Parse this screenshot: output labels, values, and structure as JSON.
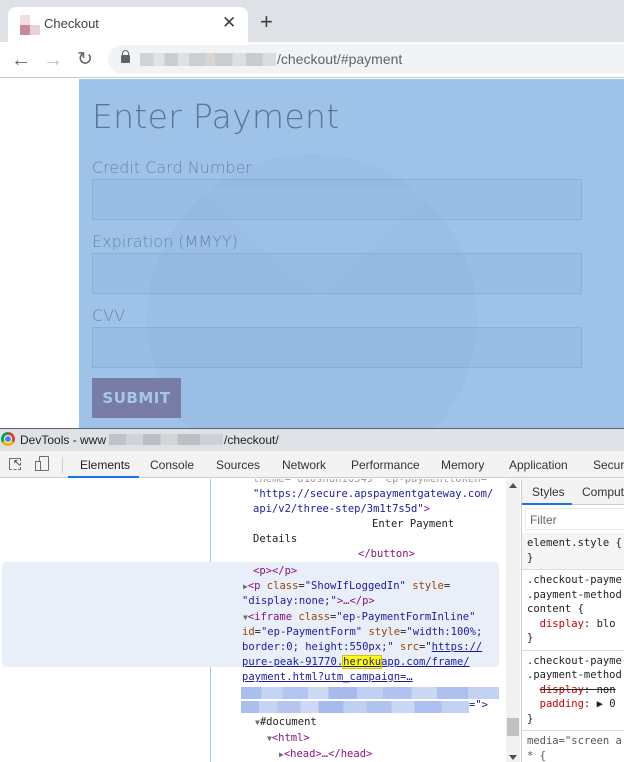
{
  "browser": {
    "tab": {
      "title": "Checkout",
      "close_glyph": "✕"
    },
    "new_tab_glyph": "+",
    "nav": {
      "back_glyph": "←",
      "forward_glyph": "→",
      "reload_glyph": "↻"
    },
    "address_bar": {
      "url_visible_suffix": "/checkout/#payment",
      "secure": true
    }
  },
  "page": {
    "title": "Enter Payment",
    "fields": [
      {
        "label": "Credit Card Number",
        "value": ""
      },
      {
        "label": "Expiration (MMYY)",
        "value": ""
      },
      {
        "label": "CVV",
        "value": ""
      }
    ],
    "submit_label": "SUBMIT",
    "colors": {
      "panel_bg": "#9fc3e8",
      "button_bg": "#7a7ca8",
      "title_color": "#557799"
    }
  },
  "devtools": {
    "window_title_prefix": "DevTools - www",
    "window_title_suffix": "/checkout/",
    "tabs": [
      "Elements",
      "Console",
      "Sources",
      "Network",
      "Performance",
      "Memory",
      "Application",
      "Securi"
    ],
    "active_tab": "Elements",
    "dom": {
      "line0": "theme= d10shun10349  ep-paymenttoken=",
      "line1_val": "\"https://secure.apspaymentgateway.com/",
      "line2_val": "api/v2/three-step/3m1t7s5d\"",
      "line3_text": "Enter Payment",
      "line4_text": "Details",
      "line5_tag": "</button>",
      "line6_tag": "<p></p>",
      "line7": {
        "tag_open": "<p ",
        "attr1": "class",
        "val1": "\"ShowIfLoggedIn\"",
        "attr2": "style",
        "eq": "="
      },
      "line8": {
        "val": "\"display:none;\"",
        "tail": ">…</p>"
      },
      "line9": {
        "tag_open": "<iframe ",
        "attr1": "class",
        "val1": "\"ep-PaymentFormInline\""
      },
      "line10": {
        "attr1": "id",
        "val1": "\"ep-PaymentForm\"",
        "attr2": "style",
        "val2": "\"width:100%;"
      },
      "line11": {
        "val": "border:0; height:550px;\"",
        "attr": "src",
        "link": "https://"
      },
      "line12": {
        "link_a": "pure-peak-91770.",
        "link_hl": "heroku",
        "link_b": "app.com/frame/"
      },
      "line13": {
        "link": "payment.html?utm_campaign=…"
      },
      "line15_tail": "=\">",
      "line16": "#document",
      "line17_tag": "<html>",
      "line18": {
        "tag": "<head>",
        "tail": "…</head>"
      }
    },
    "styles_pane": {
      "tabs": [
        "Styles",
        "Computed"
      ],
      "filter_placeholder": "Filter",
      "rules": [
        {
          "text": "element.style {\n}"
        },
        {
          "selector": ".checkout-payme\n.payment-method\ncontent {",
          "prop": "display",
          "value": ": blo",
          "close": "}"
        },
        {
          "selector": ".checkout-payme\n.payment-method",
          "prop1": "display",
          "value1": ": non",
          "prop2": "padding",
          "value2": ": ▶ 0 ",
          "close": "}"
        },
        {
          "text": "media=\"screen a\n* {"
        }
      ]
    }
  }
}
